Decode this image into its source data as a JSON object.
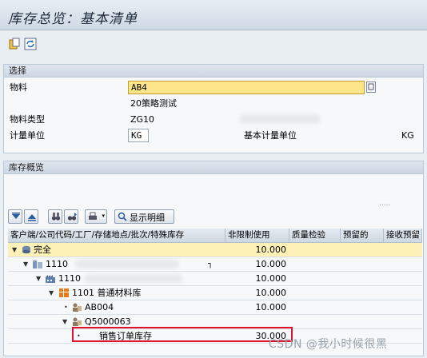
{
  "window": {
    "title": "库存总览：基本清单"
  },
  "toolbar": {
    "icons": [
      "clipboard-copy-icon",
      "refresh-icon"
    ]
  },
  "selection": {
    "header": "选择",
    "material_label": "物料",
    "material_value": "AB4",
    "material_desc": "20策略测试",
    "material_type_label": "物料类型",
    "material_type_value": "ZG10",
    "unit_label": "计量单位",
    "unit_value": "KG",
    "base_unit_label": "基本计量单位",
    "base_unit_value": "KG"
  },
  "overview": {
    "header": "库存概览",
    "toolbar": {
      "show_detail_label": "显示明细"
    },
    "columns": [
      "客户端/公司代码/工厂/存储地点/批次/特殊库存",
      "非限制使用",
      "质量检验",
      "预留的",
      "接收预留"
    ],
    "rows": [
      {
        "label": "完全",
        "unrestricted": "10.000",
        "level": 0,
        "icon": "stack-icon"
      },
      {
        "label": "1110",
        "unrestricted": "10.000",
        "level": 1,
        "icon": "company-icon"
      },
      {
        "label": "1110",
        "unrestricted": "10.000",
        "level": 2,
        "icon": "plant-icon"
      },
      {
        "label": "1101 普通材料库",
        "unrestricted": "10.000",
        "level": 3,
        "icon": "storage-icon"
      },
      {
        "label": "AB004",
        "unrestricted": "10.000",
        "level": 4,
        "icon": "batch-icon"
      },
      {
        "label": "Q5000063",
        "unrestricted": "",
        "level": 4,
        "icon": "batch-icon"
      },
      {
        "label": "销售订单库存",
        "unrestricted": "30.000",
        "level": 5,
        "icon": ""
      }
    ]
  },
  "watermark": "CSDN @我小时候很黑",
  "colors": {
    "highlight_row": "#fdf1b8",
    "focus_input": "#fde58c",
    "red_box": "#e0112d"
  }
}
